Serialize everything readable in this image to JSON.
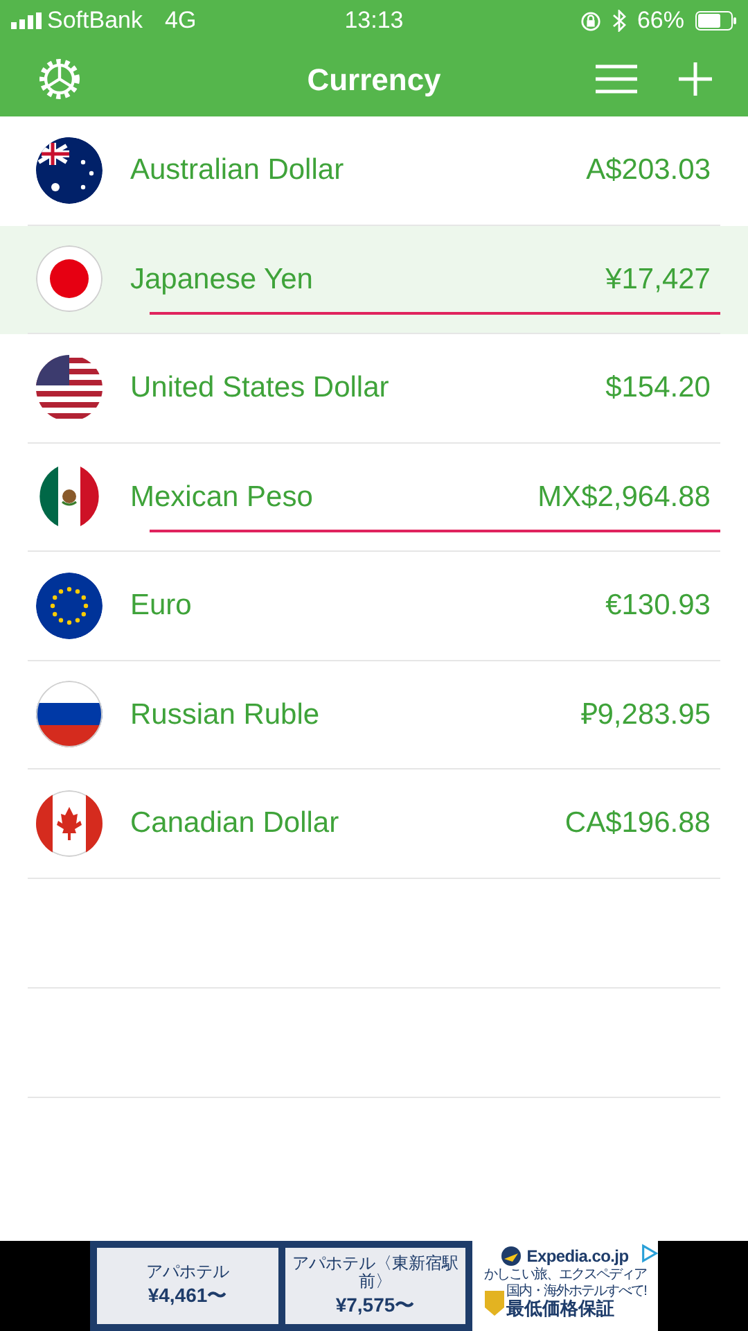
{
  "status_bar": {
    "carrier": "SoftBank",
    "network": "4G",
    "time": "13:13",
    "battery": "66%"
  },
  "nav_bar": {
    "title": "Currency"
  },
  "currencies": [
    {
      "kind": "au",
      "name": "Australian Dollar",
      "amount": "A$203.03",
      "selected": false,
      "underlined": false
    },
    {
      "kind": "jp",
      "name": "Japanese Yen",
      "amount": "¥17,427",
      "selected": true,
      "underlined": true
    },
    {
      "kind": "us",
      "name": "United States Dollar",
      "amount": "$154.20",
      "selected": false,
      "underlined": false
    },
    {
      "kind": "mx",
      "name": "Mexican Peso",
      "amount": "MX$2,964.88",
      "selected": false,
      "underlined": true
    },
    {
      "kind": "eu",
      "name": "Euro",
      "amount": "€130.93",
      "selected": false,
      "underlined": false
    },
    {
      "kind": "ru",
      "name": "Russian Ruble",
      "amount": "₽9,283.95",
      "selected": false,
      "underlined": false
    },
    {
      "kind": "ca",
      "name": "Canadian Dollar",
      "amount": "CA$196.88",
      "selected": false,
      "underlined": false
    }
  ],
  "ad": {
    "offers": [
      {
        "hotel": "アパホテル",
        "price": "¥4,461〜"
      },
      {
        "hotel": "アパホテル〈東新宿駅前〉",
        "price": "¥7,575〜"
      }
    ],
    "brand": "Expedia.co.jp",
    "tagline": "かしこい旅、エクスペディア",
    "promo_line": "国内・海外ホテルすべて!",
    "promo": "最低価格保証"
  }
}
